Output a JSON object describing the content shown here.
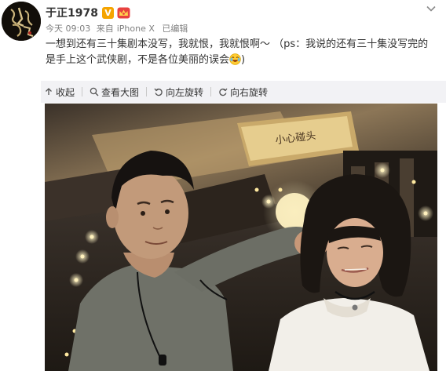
{
  "post": {
    "username": "于正1978",
    "verified_badge": "V",
    "timestamp": "今天 09:03",
    "source_prefix": "来自",
    "source_device": "iPhone X",
    "edited_label": "已编辑",
    "text_main": "一想到还有三十集剧本没写，我就恨，我就恨啊～ （ps：我说的还有三十集没写完的是手上这个武侠剧，不是各位美丽的误会",
    "text_tail": ")",
    "emoji": "laugh-emoji"
  },
  "toolbar": {
    "collapse_label": "收起",
    "view_large_label": "查看大图",
    "rotate_left_label": "向左旋转",
    "rotate_right_label": "向右旋转"
  },
  "photo": {
    "sign_text": "小心碰头"
  },
  "icons": {
    "collapse": "arrow-up-icon",
    "view_large": "magnifier-icon",
    "rotate_left": "rotate-left-icon",
    "rotate_right": "rotate-right-icon",
    "menu": "chevron-down-icon",
    "member": "crown-icon"
  },
  "colors": {
    "verified": "#f5a400",
    "member_crown": "#e8423f",
    "meta_text": "#808080",
    "toolbar_bg": "#f2f2f5"
  }
}
